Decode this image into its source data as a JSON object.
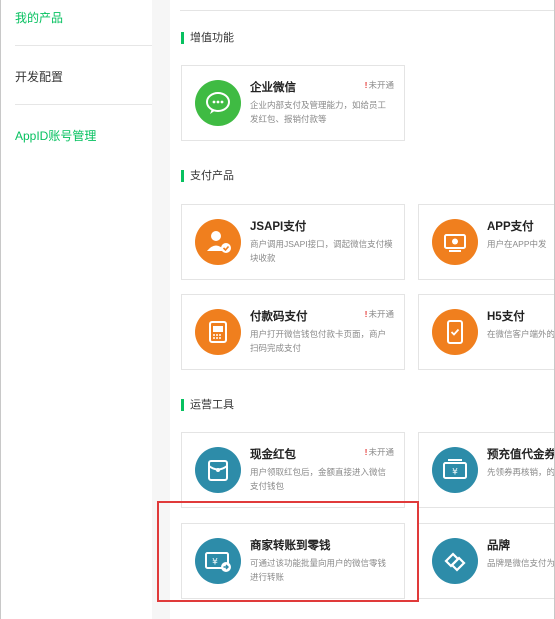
{
  "sidebar": {
    "items": [
      {
        "label": "我的产品"
      },
      {
        "label": "开发配置"
      },
      {
        "label": "AppID账号管理"
      }
    ]
  },
  "sections": [
    {
      "title": "增值功能"
    },
    {
      "title": "支付产品"
    },
    {
      "title": "运营工具"
    }
  ],
  "cards": {
    "qiye": {
      "name": "企业微信",
      "status": "未开通",
      "icon": "wechat-chat-icon",
      "desc": "企业内部支付及管理能力，如给员工发红包、报销付款等"
    },
    "jsapi": {
      "name": "JSAPI支付",
      "icon": "user-check-icon",
      "desc": "商户调用JSAPI接口，调起微信支付模块收款"
    },
    "app": {
      "name": "APP支付",
      "icon": "phone-pay-icon",
      "desc": "用户在APP中发"
    },
    "fukuanma": {
      "name": "付款码支付",
      "status": "未开通",
      "icon": "barcode-scanner-icon",
      "desc": "用户打开微信钱包付款卡页面，商户扫码完成支付"
    },
    "h5": {
      "name": "H5支付",
      "icon": "mobile-check-icon",
      "desc": "在微信客户端外的信支付"
    },
    "hongbao": {
      "name": "现金红包",
      "status": "未开通",
      "icon": "red-packet-icon",
      "desc": "用户领取红包后，金额直接进入微信支付钱包"
    },
    "chongzhi": {
      "name": "预充值代金券",
      "icon": "coupon-icon",
      "desc": "先领券再核销，的营销经费"
    },
    "zhuanzhang": {
      "name": "商家转账到零钱",
      "icon": "money-transfer-icon",
      "desc": "可通过该功能批量向用户的微信零钱进行转账"
    },
    "pinpai": {
      "name": "品牌",
      "icon": "brand-link-icon",
      "desc": "品牌是微信支付为的行业解决方案"
    }
  },
  "colors": {
    "accent": "#07c160",
    "icon_green": "#3fbb43",
    "icon_orange": "#f07f1e",
    "icon_teal": "#2d8ca9",
    "highlight": "#e03a3a"
  }
}
